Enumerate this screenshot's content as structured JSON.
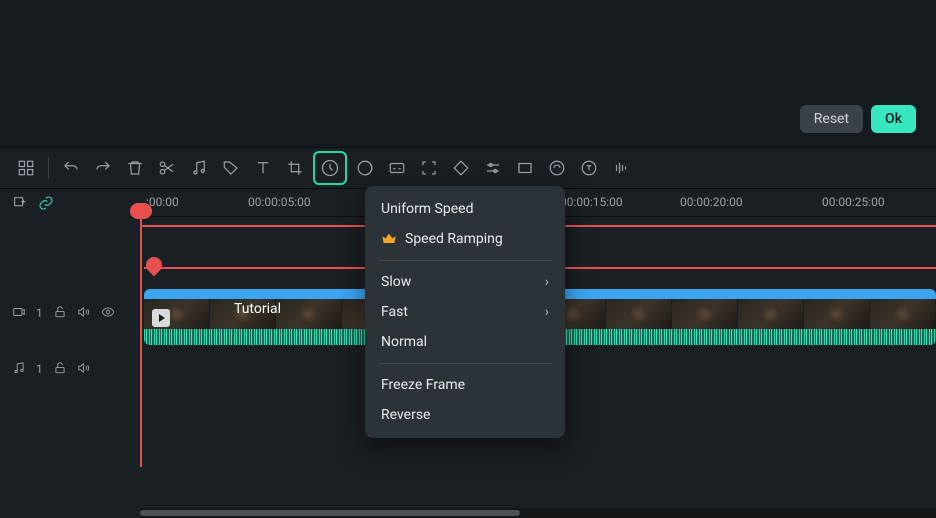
{
  "actions": {
    "reset": "Reset",
    "ok": "Ok"
  },
  "ruler": {
    "marks": [
      {
        "pos": 6,
        "label": ":00:00"
      },
      {
        "pos": 108,
        "label": "00:00:05:00"
      },
      {
        "pos": 420,
        "label": "00:00:15:00"
      },
      {
        "pos": 540,
        "label": "00:00:20:00"
      },
      {
        "pos": 682,
        "label": "00:00:25:00"
      }
    ]
  },
  "tracks": {
    "video": {
      "index": "1",
      "clip_label": "Tutorial"
    },
    "audio": {
      "index": "1"
    }
  },
  "speed_menu": {
    "items": [
      {
        "label": "Uniform Speed",
        "submenu": false,
        "premium": false
      },
      {
        "label": "Speed Ramping",
        "submenu": false,
        "premium": true
      },
      {
        "sep": true
      },
      {
        "label": "Slow",
        "submenu": true,
        "premium": false
      },
      {
        "label": "Fast",
        "submenu": true,
        "premium": false
      },
      {
        "label": "Normal",
        "submenu": false,
        "premium": false
      },
      {
        "sep": true
      },
      {
        "label": "Freeze Frame",
        "submenu": false,
        "premium": false
      },
      {
        "label": "Reverse",
        "submenu": false,
        "premium": false
      }
    ]
  }
}
